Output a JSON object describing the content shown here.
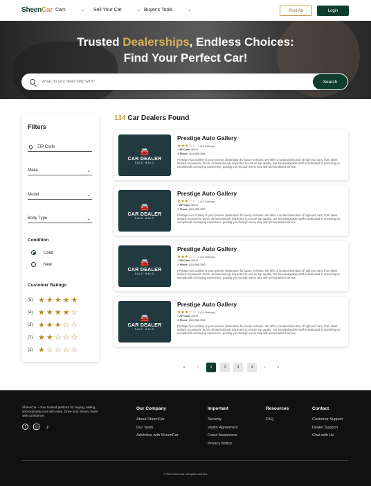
{
  "nav": {
    "logo_part1": "Sheen",
    "logo_part2": "Car",
    "menu": [
      "Cars",
      "Sell Your Car",
      "Buyer's Tools"
    ],
    "post_ad": "Post Ad",
    "login": "Login"
  },
  "hero": {
    "title_pre": "Trusted ",
    "title_highlight": "Dealerships",
    "title_post": ", Endless Choices:",
    "title_line2": "Find Your Perfect Car!",
    "search_placeholder": "What do you need help with?",
    "search_button": "Search"
  },
  "filters": {
    "title": "Filters",
    "zip_placeholder": "ZIP Code",
    "make": "Make",
    "model": "Model",
    "body_type": "Body Type",
    "condition_title": "Condition",
    "condition_used": "Used",
    "condition_new": "New",
    "condition_selected": "Used",
    "ratings_title": "Customer Ratings",
    "ratings": [
      {
        "label": "(5)",
        "stars": "★★★★★"
      },
      {
        "label": "(4)",
        "stars": "★★★★☆"
      },
      {
        "label": "(3)",
        "stars": "★★★☆☆"
      },
      {
        "label": "(2)",
        "stars": "★★☆☆☆"
      },
      {
        "label": "(1)",
        "stars": "★☆☆☆☆"
      }
    ]
  },
  "results": {
    "count": "134",
    "count_label": " Car Dealers Found"
  },
  "dealers": [
    {
      "name": "Prestige Auto Gallery",
      "stars": "★★★☆☆",
      "ratings": "3 (23 Ratings)",
      "zip_label": "ZIP Code:",
      "zip": "90210",
      "phone_label": "Phone:",
      "phone": "(310) 555-7890",
      "logo_title": "CAR DEALER",
      "logo_sub": "SALE HALO",
      "description": "Prestige Auto Gallery is your premier destination for luxury vehicles. We offer a curated selection of high-end cars, from sleek sedans to powerful SUVs, all meticulously inspected to ensure top quality. Our knowledgeable staff is dedicated to providing an exceptional car-buying experience, guiding you through every step with personalized service."
    },
    {
      "name": "Prestige Auto Gallery",
      "stars": "★★★☆☆",
      "ratings": "3 (23 Ratings)",
      "zip_label": "ZIP Code:",
      "zip": "90210",
      "phone_label": "Phone:",
      "phone": "(310) 555-7890",
      "logo_title": "CAR DEALER",
      "logo_sub": "SALE HALO",
      "description": "Prestige Auto Gallery is your premier destination for luxury vehicles. We offer a curated selection of high-end cars, from sleek sedans to powerful SUVs, all meticulously inspected to ensure top quality. Our knowledgeable staff is dedicated to providing an exceptional car-buying experience, guiding you through every step with personalized service."
    },
    {
      "name": "Prestige Auto Gallery",
      "stars": "★★★☆☆",
      "ratings": "3 (23 Ratings)",
      "zip_label": "ZIP Code:",
      "zip": "90210",
      "phone_label": "Phone:",
      "phone": "(310) 555-7890",
      "logo_title": "CAR DEALER",
      "logo_sub": "SALE HALO",
      "description": "Prestige Auto Gallery is your premier destination for luxury vehicles. We offer a curated selection of high-end cars, from sleek sedans to powerful SUVs, all meticulously inspected to ensure top quality. Our knowledgeable staff is dedicated to providing an exceptional car-buying experience, guiding you through every step with personalized service."
    },
    {
      "name": "Prestige Auto Gallery",
      "stars": "★★★☆☆",
      "ratings": "3 (23 Ratings)",
      "zip_label": "ZIP Code:",
      "zip": "90210",
      "phone_label": "Phone:",
      "phone": "(310) 555-7890",
      "logo_title": "CAR DEALER",
      "logo_sub": "SALE HALO",
      "description": "Prestige Auto Gallery is your premier destination for luxury vehicles. We offer a curated selection of high-end cars, from sleek sedans to powerful SUVs, all meticulously inspected to ensure top quality. Our knowledgeable staff is dedicated to providing an exceptional car-buying experience, guiding you through every step with personalized service."
    }
  ],
  "pagination": {
    "first": "«",
    "prev": "‹",
    "pages": [
      "1",
      "2",
      "3",
      "4"
    ],
    "current": "1",
    "next": "›",
    "last": "»"
  },
  "footer": {
    "about": "SheenCar – Your trusted platform for buying, selling, and exploring cars with ease. Drive your dream, trade with confidence.",
    "social_icons": [
      "facebook-icon",
      "instagram-icon",
      "tiktok-icon"
    ],
    "col1_title": "Our Company",
    "col1_items": [
      "About SheenCar",
      "Our Team",
      "Advertise with SheenCar"
    ],
    "col2_title": "Important",
    "col2_items": [
      "Security",
      "Visitor Agreement",
      "Fraud Awareness",
      "Privacy Notice"
    ],
    "col3_title": "Resources",
    "col3_items": [
      "FAQ"
    ],
    "col4_title": "Contact",
    "col4_items": [
      "Customer Support",
      "Dealer Support",
      "Chat with Us"
    ],
    "copyright": "© 2025 SheenCar. All rights reserved."
  },
  "colors": {
    "brand_green": "#0f3d2e",
    "brand_gold": "#c9a24a",
    "footer_bg": "#111111",
    "star": "#b58b1e"
  }
}
